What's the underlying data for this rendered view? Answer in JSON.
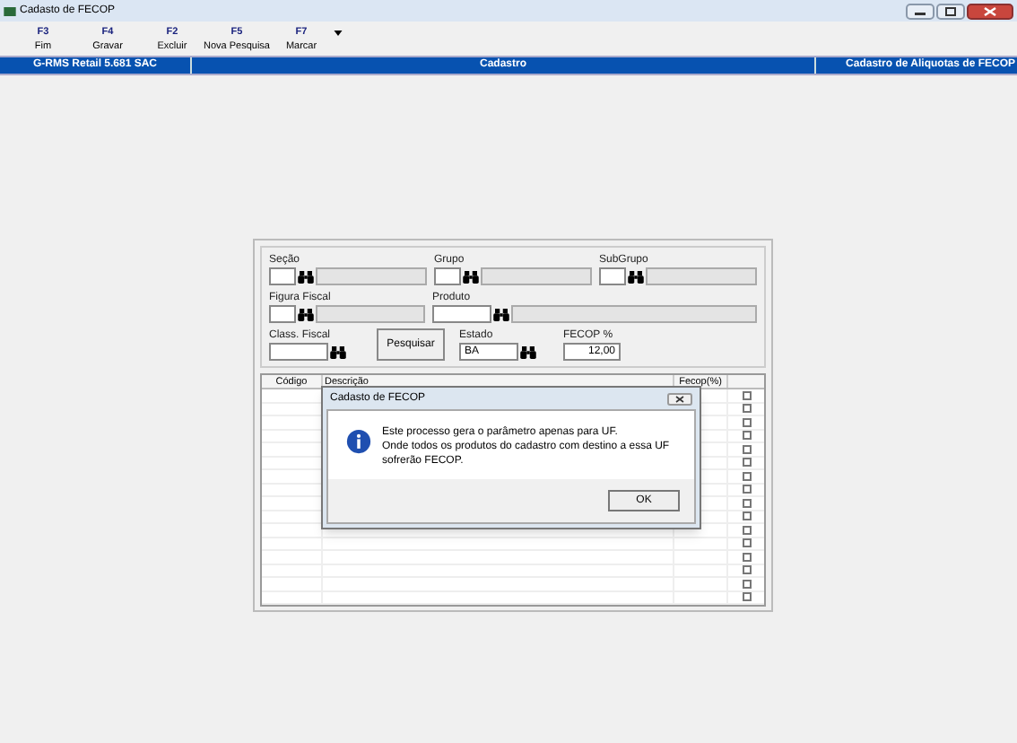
{
  "window": {
    "title": "Cadasto de FECOP"
  },
  "toolbar": [
    {
      "key": "F3",
      "label": "Fim"
    },
    {
      "key": "F4",
      "label": "Gravar"
    },
    {
      "key": "F2",
      "label": "Excluir"
    },
    {
      "key": "F5",
      "label": "Nova Pesquisa"
    },
    {
      "key": "F7",
      "label": "Marcar"
    }
  ],
  "header_bar": [
    "G-RMS Retail 5.681 SAC",
    "Cadastro",
    "Cadastro de Aliquotas de FECOP"
  ],
  "filter_rows": [
    [
      {
        "kind": "lookup",
        "label": "Seção"
      },
      {
        "kind": "lookup",
        "label": "Grupo"
      },
      {
        "kind": "lookup",
        "label": "SubGrupo"
      }
    ],
    [
      {
        "kind": "lookup",
        "label": "Figura Fiscal"
      },
      {
        "kind": "search_lookup",
        "label": "Produto"
      }
    ],
    [
      {
        "kind": "search",
        "label": "Class. Fiscal"
      },
      {
        "kind": "button",
        "label": "Pesquisar"
      },
      {
        "kind": "search",
        "label": "Estado",
        "value": "BA"
      },
      {
        "kind": "number",
        "label": "FECOP %",
        "value": "12,00"
      }
    ]
  ],
  "grid": {
    "columns": [
      "Código",
      "Descrição",
      "Fecop(%)"
    ],
    "rows": [
      {
        "checked": false
      },
      {
        "checked": false
      },
      {
        "checked": false
      },
      {
        "checked": false
      },
      {
        "checked": false
      },
      {
        "checked": false
      },
      {
        "checked": false
      },
      {
        "checked": false
      },
      {
        "checked": false
      },
      {
        "checked": false
      },
      {
        "checked": false
      },
      {
        "checked": false
      },
      {
        "checked": false
      },
      {
        "checked": false
      },
      {
        "checked": false
      },
      {
        "checked": false
      }
    ]
  },
  "dialog": {
    "title": "Cadasto de FECOP",
    "message": [
      "Este processo gera o parâmetro apenas para UF.",
      "Onde todos os produtos do cadastro com destino a essa UF sofrerão FECOP."
    ],
    "button": "OK"
  }
}
